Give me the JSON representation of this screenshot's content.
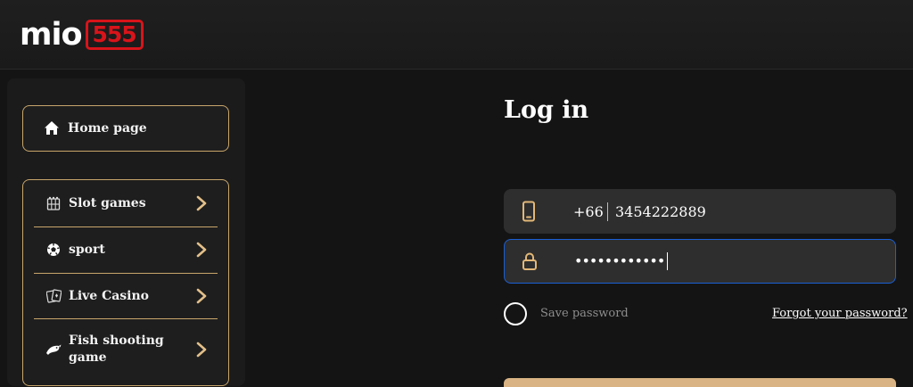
{
  "header": {
    "logo_text": "mio",
    "logo_number": "555"
  },
  "sidebar": {
    "home": {
      "label": "Home page",
      "icon": "home-icon"
    },
    "items": [
      {
        "label": "Slot games",
        "icon": "slot-machine-icon"
      },
      {
        "label": "sport",
        "icon": "soccer-ball-icon"
      },
      {
        "label": "Live Casino",
        "icon": "playing-cards-icon"
      },
      {
        "label": "Fish shooting game",
        "icon": "fish-icon"
      }
    ]
  },
  "login": {
    "title": "Log in",
    "phone_prefix": "+66",
    "phone_value": "3454222889",
    "password_value": "••••••••••••",
    "save_password_label": "Save password",
    "forgot_password_label": "Forgot your password?"
  },
  "colors": {
    "accent_gold": "#c9a66b",
    "brand_red": "#d8141a",
    "focus_blue": "#1a5fd6",
    "button_gold": "#d9b383"
  }
}
